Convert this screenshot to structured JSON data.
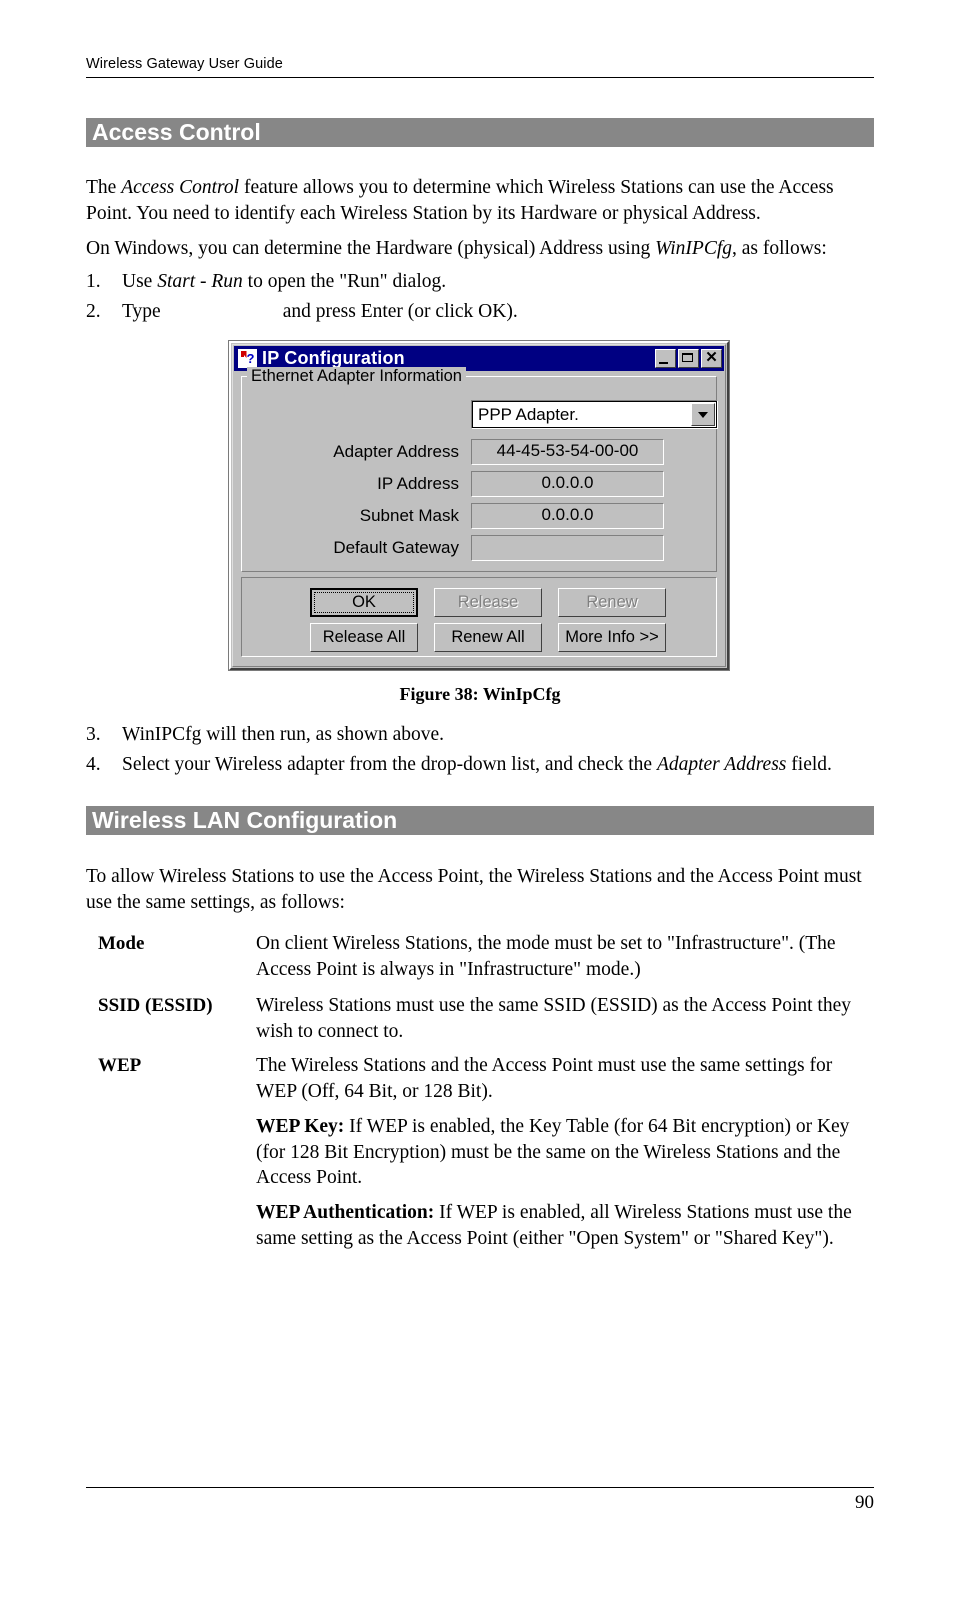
{
  "running_head": "Wireless Gateway User Guide",
  "page_number": "90",
  "sections": {
    "access_control": {
      "heading": "Access Control",
      "para1_pre": "The ",
      "para1_em": "Access Control",
      "para1_post": " feature allows you to determine which Wireless Stations can use the Access Point. You need to identify each Wireless Station by its Hardware or physical Address.",
      "para2_pre": "On Windows, you can determine the Hardware (physical) Address using ",
      "para2_em": "WinIPCfg",
      "para2_post": ", as follows:",
      "steps": [
        {
          "num": "1.",
          "pre": "Use ",
          "em": "Start - Run",
          "post": " to open the \"Run\" dialog."
        },
        {
          "num": "2.",
          "pre": "Type",
          "em": "",
          "post": "and press Enter (or click OK)."
        },
        {
          "num": "3.",
          "pre": "WinIPCfg will then run, as shown above.",
          "em": "",
          "post": ""
        },
        {
          "num": "4.",
          "pre": "Select your Wireless adapter from the drop-down list, and check the ",
          "em": "Adapter Address",
          "post": " field."
        }
      ],
      "figure_caption": "Figure 38: WinIpCfg"
    },
    "wireless_lan": {
      "heading": "Wireless LAN Configuration",
      "intro": "To allow Wireless Stations to use the Access Point, the Wireless Stations and the Access Point must use the same settings, as follows:",
      "definitions": [
        {
          "term": "Mode",
          "paragraphs": [
            {
              "bold_lead": "",
              "text": "On client Wireless Stations, the mode must be set to \"Infrastructure\". (The Access Point is always in \"Infrastructure\" mode.)"
            }
          ]
        },
        {
          "term": "SSID (ESSID)",
          "paragraphs": [
            {
              "bold_lead": "",
              "text": "Wireless Stations must use the same SSID (ESSID) as the Access Point they wish to connect to."
            }
          ]
        },
        {
          "term": "WEP",
          "paragraphs": [
            {
              "bold_lead": "",
              "text": "The Wireless Stations and the Access Point must use the same settings for WEP (Off, 64 Bit, or 128 Bit)."
            },
            {
              "bold_lead": "WEP Key:",
              "text": "  If WEP is enabled, the Key Table (for 64 Bit encryption) or Key (for 128 Bit Encryption) must be the same on the Wireless Stations and the Access Point."
            },
            {
              "bold_lead": "WEP Authentication:",
              "text": "  If WEP is enabled, all Wireless Stations must use the same setting as the Access Point (either \"Open System\" or \"Shared Key\")."
            }
          ]
        }
      ]
    }
  },
  "figure": {
    "window_title": "IP Configuration",
    "title_icon": "ip-config-help-icon",
    "window_buttons": {
      "minimize": "minimize-icon",
      "maximize": "maximize-icon",
      "close": "close-icon"
    },
    "group_legend": "Ethernet  Adapter Information",
    "adapter_combo": {
      "value": "PPP Adapter.",
      "dropdown_icon": "chevron-down-icon"
    },
    "fields": [
      {
        "label": "Adapter Address",
        "value": "44-45-53-54-00-00"
      },
      {
        "label": "IP Address",
        "value": "0.0.0.0"
      },
      {
        "label": "Subnet Mask",
        "value": "0.0.0.0"
      },
      {
        "label": "Default Gateway",
        "value": ""
      }
    ],
    "buttons": [
      {
        "label": "OK",
        "state": "default"
      },
      {
        "label": "Release",
        "state": "disabled",
        "mnemonic_index": 5
      },
      {
        "label": "Renew",
        "state": "disabled",
        "mnemonic_index": 3
      },
      {
        "label": "Release All",
        "state": "enabled",
        "mnemonic_index": 5
      },
      {
        "label": "Renew All",
        "state": "enabled",
        "mnemonic_index": 3
      },
      {
        "label": "More Info >>",
        "state": "enabled",
        "mnemonic_index": 0
      }
    ]
  },
  "colors": {
    "section_bar": "#878787",
    "titlebar": "#000082",
    "dialog_face": "#c0c0c0",
    "disabled_text": "#808080"
  }
}
